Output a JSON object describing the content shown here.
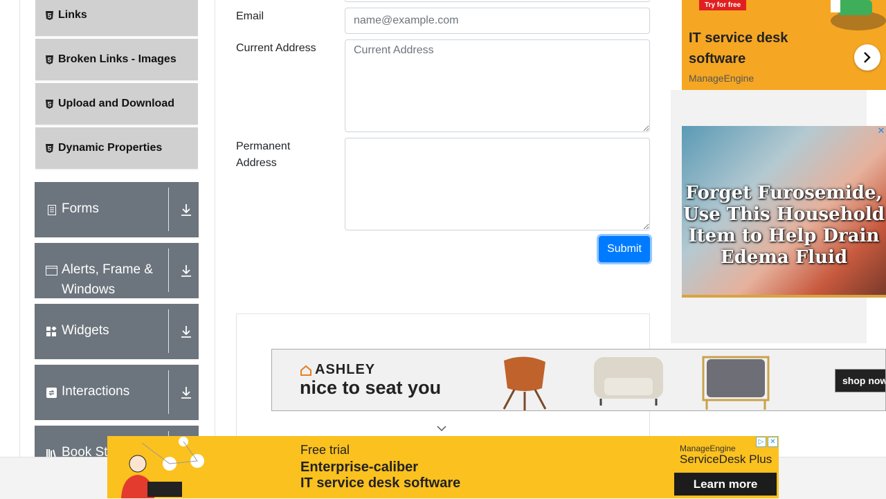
{
  "sidebar": {
    "sub_items": [
      {
        "label": "Links"
      },
      {
        "label": "Broken Links - Images"
      },
      {
        "label": "Upload and Download"
      },
      {
        "label": "Dynamic Properties"
      }
    ],
    "groups": [
      {
        "label": "Forms"
      },
      {
        "label": "Alerts, Frame & Windows"
      },
      {
        "label": "Widgets"
      },
      {
        "label": "Interactions"
      },
      {
        "label": "Book Store Application"
      }
    ]
  },
  "form": {
    "email_label": "Email",
    "email_placeholder": "name@example.com",
    "email_value": "",
    "current_address_label": "Current Address",
    "current_address_placeholder": "Current Address",
    "current_address_value": "",
    "permanent_address_label": "Permanent Address",
    "permanent_address_value": "",
    "submit_label": "Submit"
  },
  "ads": {
    "ad1": {
      "tag": "Try for free",
      "title": "IT service desk software",
      "brand": "ManageEngine"
    },
    "ad2": {
      "headline": "Forget Furosemide, Use This Household Item to Help Drain Edema Fluid",
      "close": "✕"
    },
    "ashley": {
      "brand": "ASHLEY",
      "slogan": "nice to seat you",
      "shop": "shop now"
    },
    "ad3": {
      "free_trial": "Free trial",
      "line1": "Enterprise-caliber",
      "line2": "IT service desk software",
      "vendor": "ManageEngine",
      "product": "ServiceDesk Plus",
      "cta": "Learn more"
    }
  },
  "colors": {
    "primary": "#007bff",
    "sidebar_group": "#6c757d",
    "sidebar_item": "#d0d0d0",
    "ad_yellow": "#fbc11e"
  }
}
